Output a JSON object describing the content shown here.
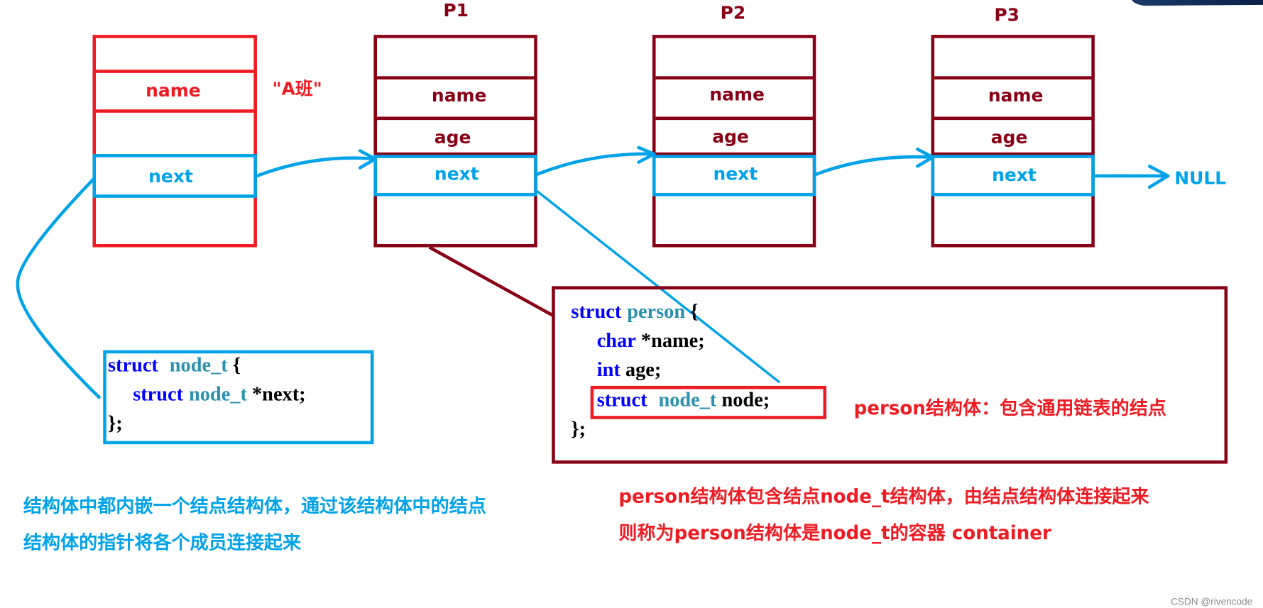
{
  "colors": {
    "head_red": "#ed1c24",
    "node_maroon": "#880015",
    "link_blue": "#00a2e8",
    "kw_blue": "#0000ff",
    "type_teal": "#2b91af",
    "code_black": "#000000"
  },
  "head_node": {
    "fields": [
      "",
      "name",
      "",
      "next",
      ""
    ],
    "name_value": "\"A班\""
  },
  "nodes": [
    {
      "title": "P1",
      "fields": [
        "",
        "name",
        "age",
        "next",
        ""
      ]
    },
    {
      "title": "P2",
      "fields": [
        "",
        "name",
        "age",
        "next",
        ""
      ]
    },
    {
      "title": "P3",
      "fields": [
        "",
        "name",
        "age",
        "next",
        ""
      ]
    }
  ],
  "null_label": "NULL",
  "node_t_code": {
    "line1": {
      "kw": "struct",
      "type": "node_t",
      "rest": " {"
    },
    "line2": {
      "kw": "struct",
      "type": "node_t",
      "rest": " *next;"
    },
    "line3": "};"
  },
  "person_code": {
    "line1": {
      "kw": "struct",
      "type": "person",
      "rest": " {"
    },
    "line2": {
      "kw": "char",
      "rest": " *name;"
    },
    "line3": {
      "kw": "int",
      "rest": " age;"
    },
    "line4": {
      "kw": "struct",
      "type": "node_t",
      "rest": " node;"
    },
    "line5": "};"
  },
  "person_note": "person结构体：包含通用链表的结点",
  "caption_left": {
    "line1": "结构体中都内嵌一个结点结构体，通过该结构体中的结点",
    "line2": "结构体的指针将各个成员连接起来"
  },
  "caption_right": {
    "line1": "person结构体包含结点node_t结构体，由结点结构体连接起来",
    "line2": "则称为person结构体是node_t的容器 container"
  },
  "watermark": "CSDN @rivencode"
}
